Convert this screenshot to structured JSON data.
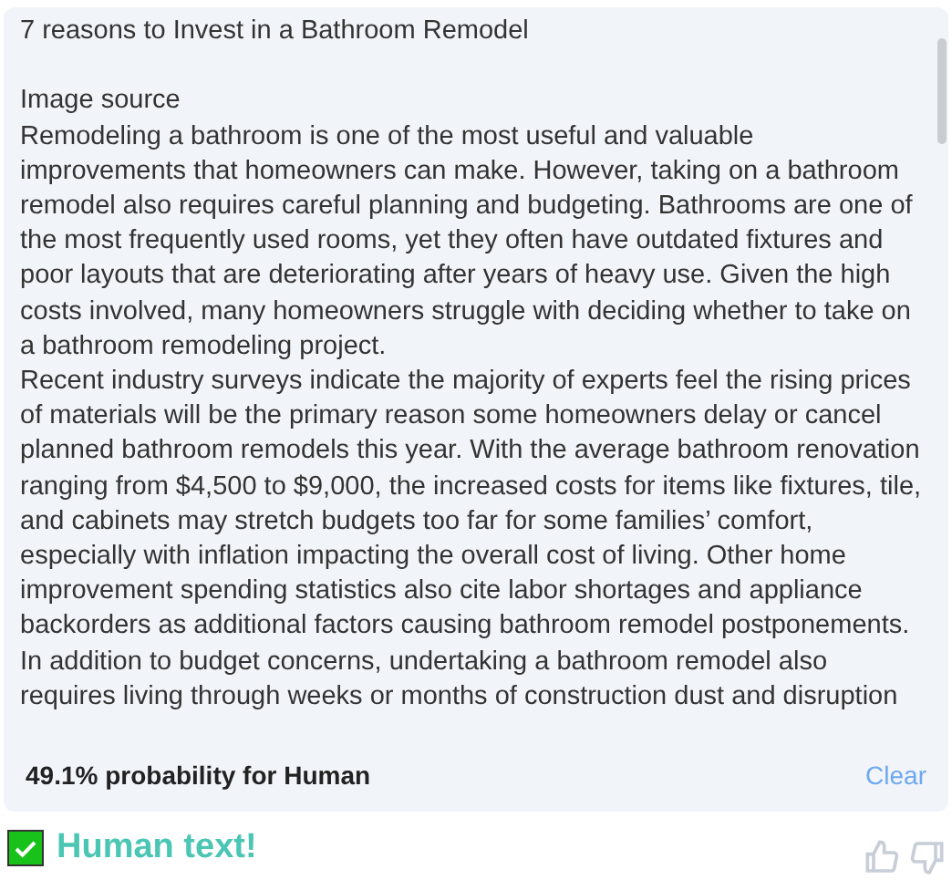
{
  "article": {
    "title": "7 reasons to Invest in a Bathroom Remodel",
    "paragraphs": [
      "Image source",
      "Remodeling a bathroom is one of the most useful and valuable improvements that homeowners can make. However, taking on a bathroom remodel also requires careful planning and budgeting. Bathrooms are one of the most frequently used rooms, yet they often have outdated fixtures and poor layouts that are deteriorating after years of heavy use. Given the high costs involved, many homeowners struggle with deciding whether to take on a bathroom remodeling project.",
      "Recent industry surveys indicate the majority of experts feel the rising prices of materials will be the primary reason some homeowners delay or cancel planned bathroom remodels this year. With the average bathroom renovation ranging from $4,500 to $9,000, the increased costs for items like fixtures, tile, and cabinets may stretch budgets too far for some families’ comfort, especially with inflation impacting the overall cost of living. Other home improvement spending statistics also cite labor shortages and appliance backorders as additional factors causing bathroom remodel postponements.",
      "In addition to budget concerns, undertaking a bathroom remodel also requires living through weeks or months of construction dust and disruption"
    ]
  },
  "result": {
    "probability": "49.1% probability for Human",
    "clear": "Clear"
  },
  "verdict": {
    "text": "Human text!",
    "passed": true
  }
}
